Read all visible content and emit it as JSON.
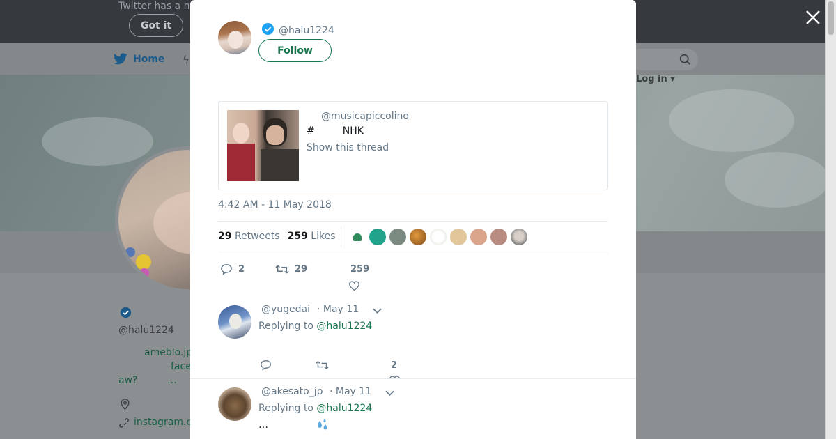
{
  "background": {
    "notice_text": "Twitter has a n",
    "got_it_label": "Got it",
    "nav_home_label": "Home",
    "login_label": "Log in",
    "profile_name": "",
    "profile_handle": "@halu1224",
    "bio_link1": "ameblo.jp",
    "bio_link2": "face",
    "bio_text": "aw?",
    "bio_ellipsis": "…",
    "instagram_link": "instagram.c"
  },
  "tweet": {
    "handle": "@halu1224",
    "follow_label": "Follow",
    "text": "",
    "quote": {
      "handle": "@musicapiccolino",
      "line": "#         NHK",
      "thread_label": "Show this thread"
    },
    "timestamp": "4:42 AM - 11 May 2018",
    "retweets_count": "29",
    "retweets_label": "Retweets",
    "likes_count": "259",
    "likes_label": "Likes",
    "actions": {
      "replies": "2",
      "retweets": "29",
      "likes": "259"
    }
  },
  "replies": [
    {
      "handle": "@yugedai",
      "date": "· May 11",
      "replying_prefix": "Replying to",
      "replying_to": "@halu1224",
      "likes": "2"
    },
    {
      "handle": "@akesato_jp",
      "date": "· May 11",
      "replying_prefix": "Replying to",
      "replying_to": "@halu1224",
      "text": "…"
    }
  ],
  "colors": {
    "accent": "#17764e",
    "verified": "#1da1f2",
    "muted": "#657786"
  }
}
